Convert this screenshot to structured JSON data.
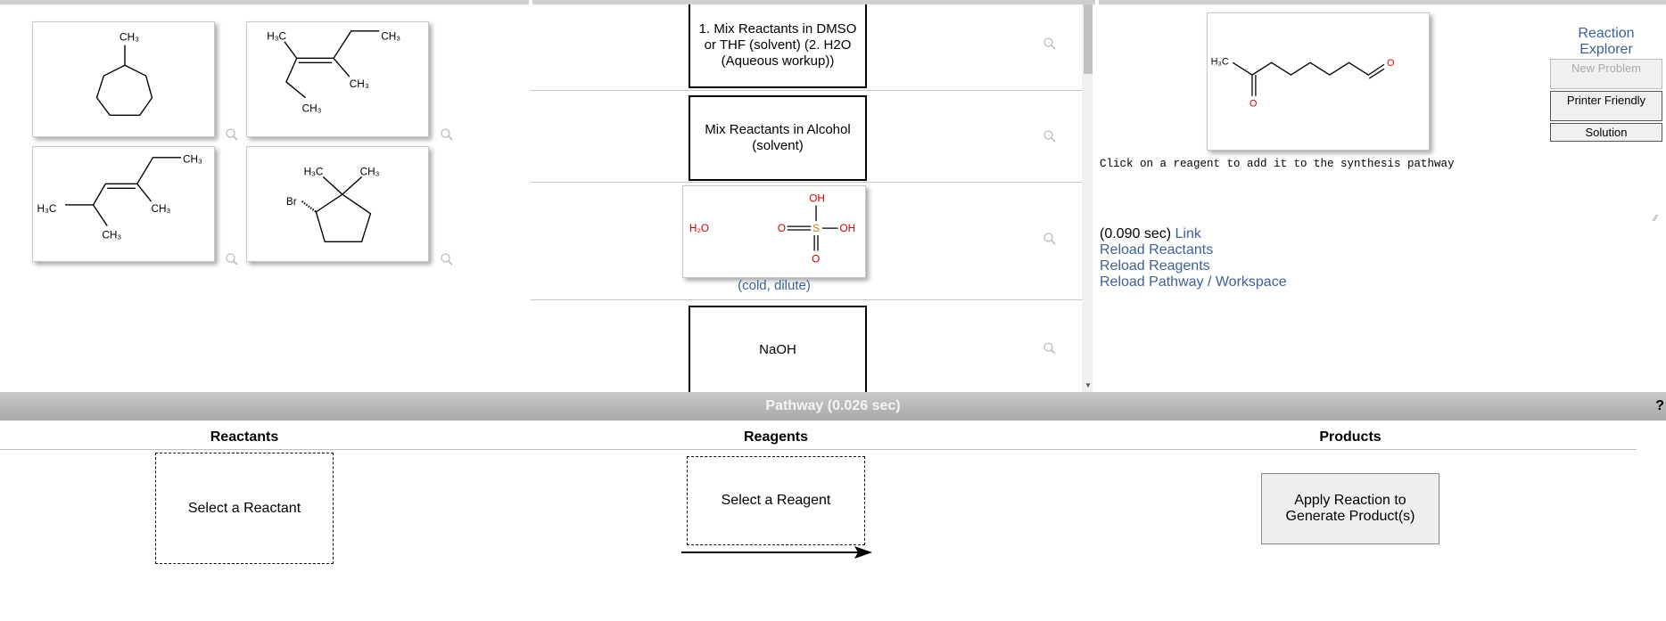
{
  "colors": {
    "link": "#3d6199",
    "pathway_bar": "#b5b5b5",
    "oxygen": "#cc0000",
    "sulfur": "#b8860b"
  },
  "reactants_panel": {
    "molecules": [
      {
        "name": "methylcycloheptane",
        "labels": [
          "CH3"
        ]
      },
      {
        "name": "3-methyl-2-pentene-like",
        "labels": [
          "H3C",
          "CH3",
          "CH3",
          "CH3"
        ]
      },
      {
        "name": "2,4-dimethylhex-3-ene-like",
        "labels": [
          "CH3",
          "H3C",
          "CH3",
          "CH3"
        ]
      },
      {
        "name": "1-bromo-2,2-dimethylcyclopentane",
        "labels": [
          "H3C",
          "CH3",
          "Br"
        ]
      }
    ]
  },
  "reagents_panel": {
    "items": [
      {
        "label": "1. Mix Reactants in DMSO or THF (solvent) (2. H2O (Aqueous workup))"
      },
      {
        "label": "Mix Reactants in Alcohol (solvent)"
      },
      {
        "label": "H2O / H2SO4",
        "caption": "(cold, dilute)"
      },
      {
        "label": "NaOH"
      }
    ]
  },
  "target_panel": {
    "molecule_labels": [
      "H3C",
      "O",
      "O"
    ],
    "hint": "Click on a reagent to add it to the synthesis pathway",
    "timing": "(0.090 sec)",
    "link_label": "Link",
    "reload_reactants": "Reload Reactants",
    "reload_reagents": "Reload Reagents",
    "reload_pathway": "Reload Pathway / Workspace"
  },
  "side_buttons": {
    "reaction_explorer": "Reaction Explorer",
    "new_problem": "New Problem",
    "printer_friendly": "Printer Friendly",
    "solution": "Solution"
  },
  "pathway": {
    "title": "Pathway (0.026 sec)",
    "help": "?",
    "reactants_header": "Reactants",
    "reagents_header": "Reagents",
    "products_header": "Products",
    "select_reactant": "Select a Reactant",
    "select_reagent": "Select a Reagent",
    "apply_button": "Apply Reaction to Generate Product(s)"
  }
}
